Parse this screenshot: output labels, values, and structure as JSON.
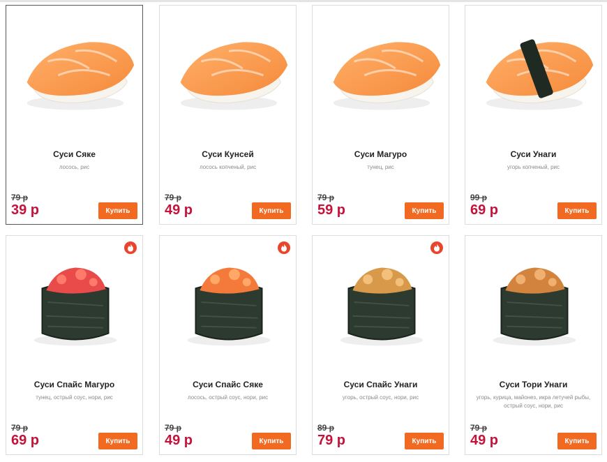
{
  "products": [
    {
      "name": "Суси Сяке",
      "desc": "лосось, рис",
      "old_price": "79 р",
      "price": "39 р",
      "buy_label": "Купить",
      "icon": "salmon-nigiri",
      "hot": false,
      "colors": {
        "top": "#f58a3a",
        "top2": "#ffb06a"
      }
    },
    {
      "name": "Суси Кунсей",
      "desc": "лосось копченый, рис",
      "old_price": "79 р",
      "price": "49 р",
      "buy_label": "Купить",
      "icon": "smoked-salmon-nigiri",
      "hot": false,
      "colors": {
        "top": "#ef4b2a",
        "top2": "#ff8a5a"
      }
    },
    {
      "name": "Суси Магуро",
      "desc": "тунец, рис",
      "old_price": "79 р",
      "price": "59 р",
      "buy_label": "Купить",
      "icon": "tuna-nigiri",
      "hot": false,
      "colors": {
        "top": "#f2415a",
        "top2": "#ff7f8c"
      }
    },
    {
      "name": "Суси Унаги",
      "desc": "угорь копченый, рис",
      "old_price": "99 р",
      "price": "69 р",
      "buy_label": "Купить",
      "icon": "eel-nigiri",
      "hot": false,
      "colors": {
        "top": "#b8742e",
        "top2": "#e0a45c"
      }
    },
    {
      "name": "Суси Спайс Магуро",
      "desc": "тунец, острый соус, нори, рис",
      "old_price": "79 р",
      "price": "69 р",
      "buy_label": "Купить",
      "icon": "spicy-tuna-gunkan",
      "hot": true,
      "colors": {
        "top": "#e94a4a",
        "top2": "#ff7a6a"
      }
    },
    {
      "name": "Суси Спайс Сяке",
      "desc": "лосось, острый соус, нори, рис",
      "old_price": "79 р",
      "price": "49 р",
      "buy_label": "Купить",
      "icon": "spicy-salmon-gunkan",
      "hot": true,
      "colors": {
        "top": "#f37a3a",
        "top2": "#ffa868"
      }
    },
    {
      "name": "Суси Спайс Унаги",
      "desc": "угорь, острый соус, нори, рис",
      "old_price": "89 р",
      "price": "79 р",
      "buy_label": "Купить",
      "icon": "spicy-eel-gunkan",
      "hot": true,
      "colors": {
        "top": "#d89a4a",
        "top2": "#f2c07a"
      }
    },
    {
      "name": "Суси Тори Унаги",
      "desc": "угорь, курица, майонез, икра летучей рыбы, острый соус, нори, рис",
      "old_price": "79 р",
      "price": "49 р",
      "buy_label": "Купить",
      "icon": "chicken-eel-gunkan",
      "hot": false,
      "colors": {
        "top": "#d2843e",
        "top2": "#f0b070"
      }
    }
  ]
}
